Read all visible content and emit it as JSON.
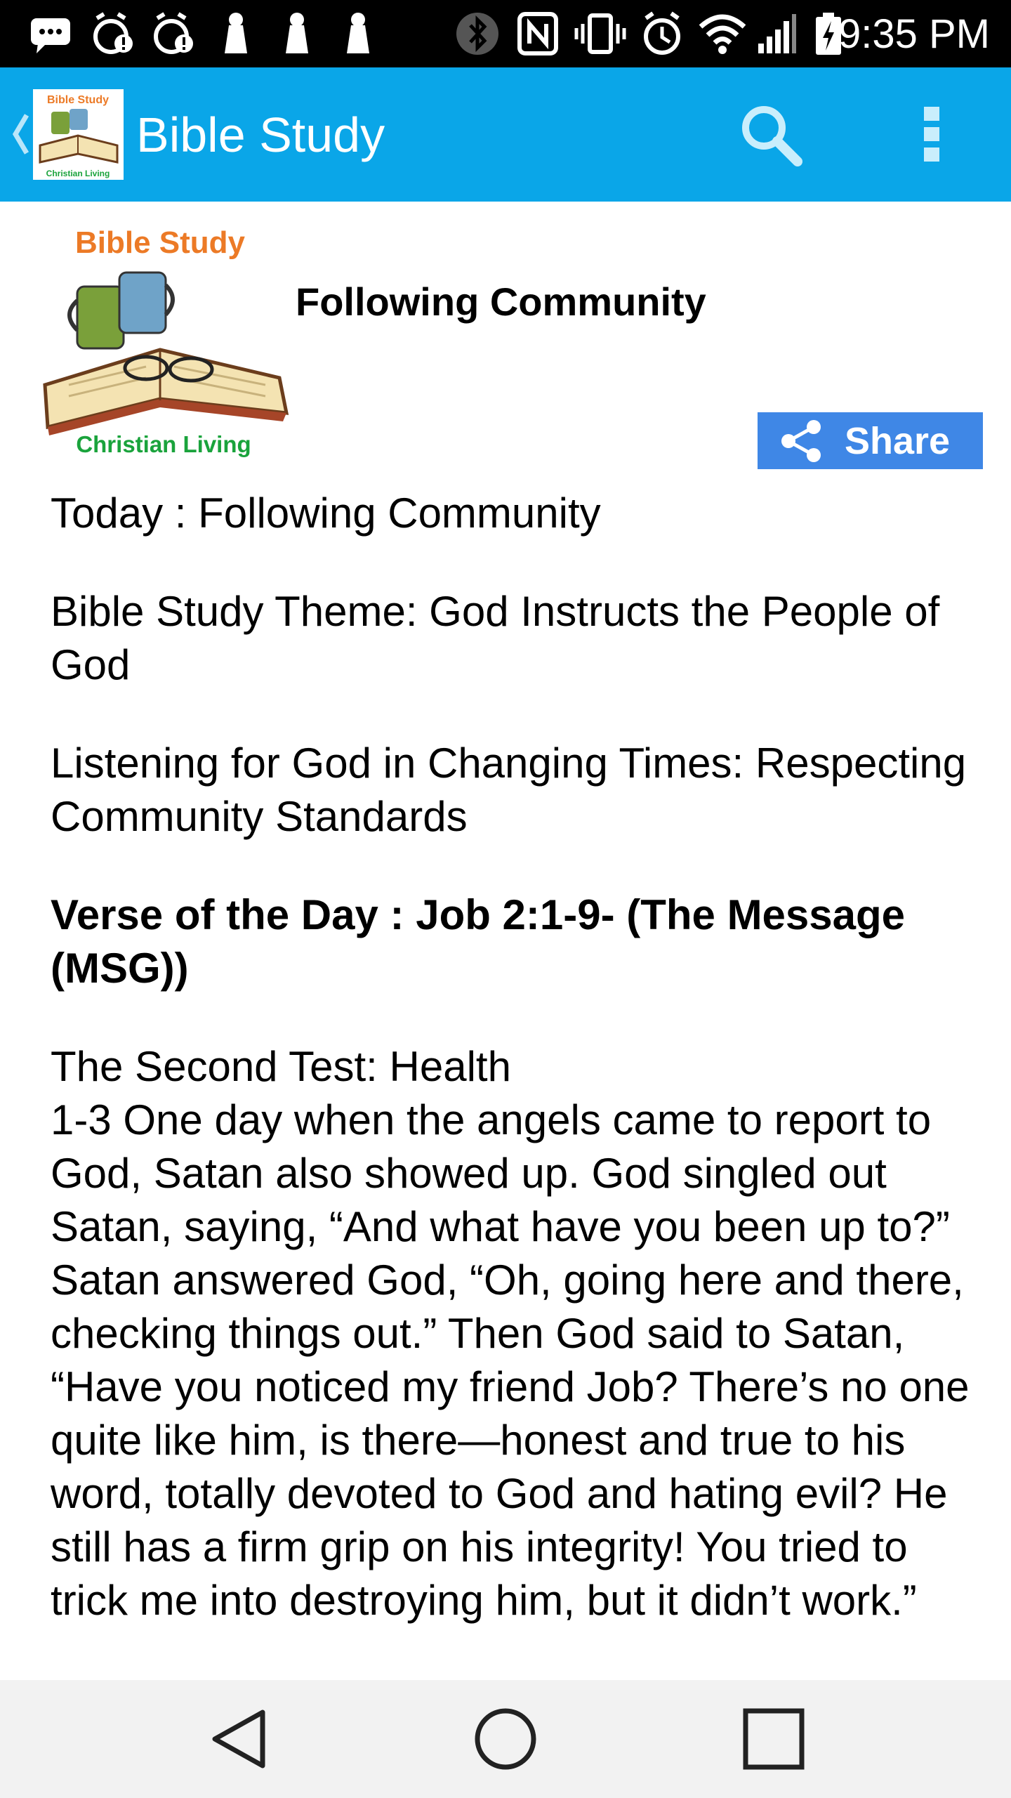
{
  "status_bar": {
    "time": "9:35 PM",
    "icons": [
      "message-icon",
      "alarm-alert-icon",
      "alarm-alert-icon",
      "notification-icon",
      "notification-icon",
      "notification-icon",
      "bluetooth-icon",
      "nfc-icon",
      "vibrate-icon",
      "alarm-icon",
      "wifi-icon",
      "signal-icon",
      "battery-charging-icon"
    ]
  },
  "action_bar": {
    "title": "Bible Study",
    "background": "#0aa6e8",
    "logo_top_text": "Bible Study",
    "logo_bottom_text": "Christian Living"
  },
  "header": {
    "logo_top_text": "Bible Study",
    "logo_bottom_text": "Christian Living",
    "title": "Following Community",
    "share_label": "Share",
    "share_color": "#3f87e6"
  },
  "content": {
    "today": "Today : Following Community",
    "theme": "Bible Study Theme: God Instructs the People of God",
    "listening": "Listening for God in Changing Times: Respecting Community Standards",
    "verse_heading": "Verse of the Day : Job 2:1-9- (The Message (MSG))",
    "passage": "The Second Test: Health\n 1-3 One day when the angels came to report to God, Satan also showed up. God singled out Satan, saying, “And what have you been up to?” Satan answered God, “Oh, going here and there, checking things out.” Then God said to Satan, “Have you noticed my friend Job? There’s no one quite like him, is there—honest and true to his word, totally devoted to God and hating evil? He still has a firm grip on his integrity! You tried to trick me into destroying him, but it didn’t work.”"
  },
  "nav_bar": {
    "buttons": [
      "back-nav-icon",
      "home-nav-icon",
      "recents-nav-icon"
    ]
  }
}
